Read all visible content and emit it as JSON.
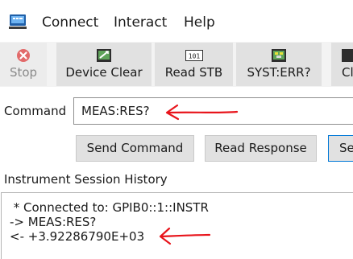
{
  "menu": {
    "items": [
      "Connect",
      "Interact",
      "Help"
    ]
  },
  "toolbar": {
    "stop_label": "Stop",
    "device_clear_label": "Device Clear",
    "read_stb_label": "Read STB",
    "syst_err_label": "SYST:ERR?",
    "cl_label": "Cl",
    "read_stb_icon_text": "101"
  },
  "command": {
    "label": "Command",
    "value": "MEAS:RES?"
  },
  "actions": {
    "send_label": "Send Command",
    "read_label": "Read Response",
    "se_label": "Se"
  },
  "history": {
    "label": "Instrument Session History",
    "lines": [
      " * Connected to: GPIB0::1::INSTR",
      "-> MEAS:RES?",
      "<- +3.92286790E+03"
    ]
  },
  "colors": {
    "annotation": "#e8141b",
    "stop_icon": "#e05555",
    "focus_border": "#0078d7"
  }
}
